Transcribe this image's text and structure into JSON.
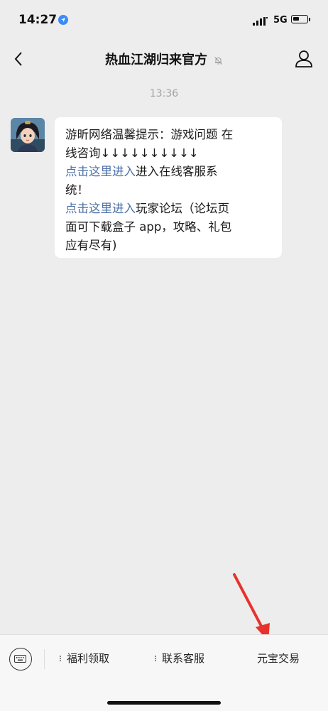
{
  "status_bar": {
    "time": "14:27",
    "network": "5G"
  },
  "nav": {
    "title": "热血江湖归来官方"
  },
  "chat": {
    "timestamp": "13:36",
    "message": {
      "line1": "游昕网络温馨提示：游戏问题 在",
      "line2": "线咨询↓↓↓↓↓↓↓↓↓↓",
      "link1": "点击这里进入",
      "line3_rest": "进入在线客服系",
      "line4": "统！",
      "link2": "点击这里进入",
      "line5_rest": "玩家论坛（论坛页",
      "line6": "面可下载盒子 app，攻略、礼包",
      "line7": "应有尽有)"
    }
  },
  "bottom_menu": {
    "items": [
      {
        "label": "福利领取"
      },
      {
        "label": "联系客服"
      },
      {
        "label": "元宝交易"
      }
    ]
  },
  "colors": {
    "background": "#ededed",
    "link": "#4a6fa6",
    "annotation_arrow": "#e8322c"
  }
}
